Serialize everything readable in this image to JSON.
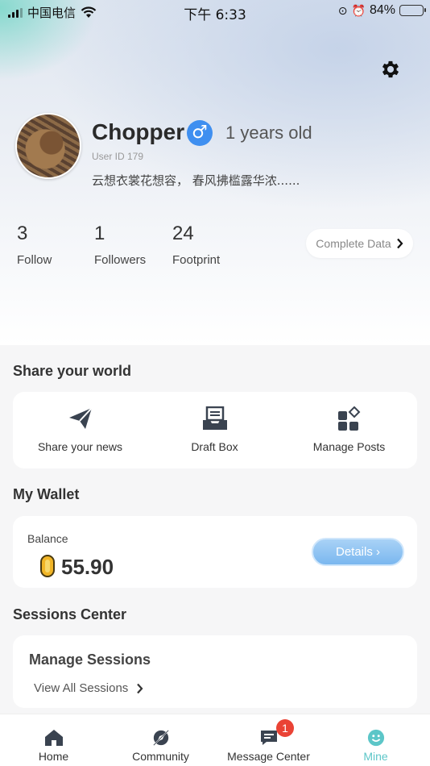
{
  "status_bar": {
    "carrier": "中国电信",
    "time": "下午 6:33",
    "battery_text": "84%",
    "battery_level": 0.84
  },
  "profile": {
    "name": "Chopper",
    "gender_symbol": "♂",
    "age": "1 years old",
    "user_id": "User ID 179",
    "bio": "云想衣裳花想容， 春风拂槛露华浓......",
    "stats": [
      {
        "value": "3",
        "label": "Follow"
      },
      {
        "value": "1",
        "label": "Followers"
      },
      {
        "value": "24",
        "label": "Footprint"
      }
    ],
    "complete_data_label": "Complete Data"
  },
  "share": {
    "title": "Share your world",
    "items": [
      {
        "label": "Share your news",
        "icon": "paper-plane-icon"
      },
      {
        "label": "Draft Box",
        "icon": "inbox-icon"
      },
      {
        "label": "Manage Posts",
        "icon": "grid-icon"
      }
    ]
  },
  "wallet": {
    "title": "My Wallet",
    "balance_label": "Balance",
    "balance_value": "55.90",
    "details_label": "Details"
  },
  "sessions": {
    "title": "Sessions Center",
    "card_title": "Manage Sessions",
    "link_label": "View All Sessions"
  },
  "tabbar": {
    "items": [
      {
        "label": "Home",
        "icon": "home-icon"
      },
      {
        "label": "Community",
        "icon": "compass-icon"
      },
      {
        "label": "Message Center",
        "icon": "chat-icon",
        "badge": "1"
      },
      {
        "label": "Mine",
        "icon": "smiley-icon"
      }
    ],
    "active_color": "#5cc6c8"
  },
  "colors": {
    "accent": "#3f8ff0",
    "details_button": "#7ab7ef",
    "badge": "#ea4335"
  }
}
